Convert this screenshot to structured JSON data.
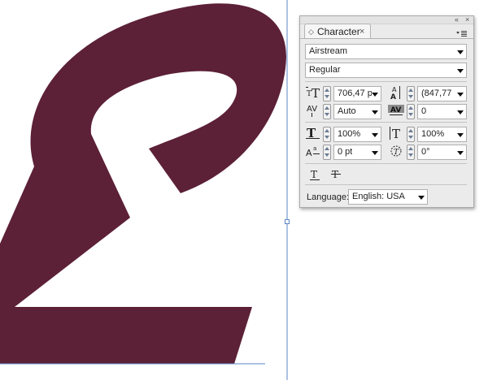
{
  "colors": {
    "glyph_fill": "#5c2037",
    "guide_line": "#5b86c7",
    "panel_bg": "#ebebeb"
  },
  "panel": {
    "title": "Character",
    "tab_icon": "double-diamond-icon",
    "close_glyph": "×",
    "collapse_glyph": "«",
    "win_close_glyph": "×",
    "menu_icon": "panel-menu-icon"
  },
  "font": {
    "family": "Airstream",
    "style": "Regular"
  },
  "fields": {
    "font_size": {
      "icon": "font-size-icon",
      "value": "706,47 p"
    },
    "leading": {
      "icon": "leading-icon",
      "value": "(847,77"
    },
    "kerning": {
      "icon": "kerning-icon",
      "value": "Auto"
    },
    "tracking": {
      "icon": "tracking-icon",
      "value": "0"
    },
    "horizontal_scale": {
      "icon": "horizontal-scale-icon",
      "value": "100%"
    },
    "vertical_scale": {
      "icon": "vertical-scale-icon",
      "value": "100%"
    },
    "baseline_shift": {
      "icon": "baseline-shift-icon",
      "value": "0 pt"
    },
    "skew": {
      "icon": "skew-icon",
      "value": "0°"
    }
  },
  "styles": {
    "underline_icon": "underline-icon",
    "strikethrough_icon": "strikethrough-icon"
  },
  "language": {
    "label": "Language:",
    "value": "English: USA"
  }
}
